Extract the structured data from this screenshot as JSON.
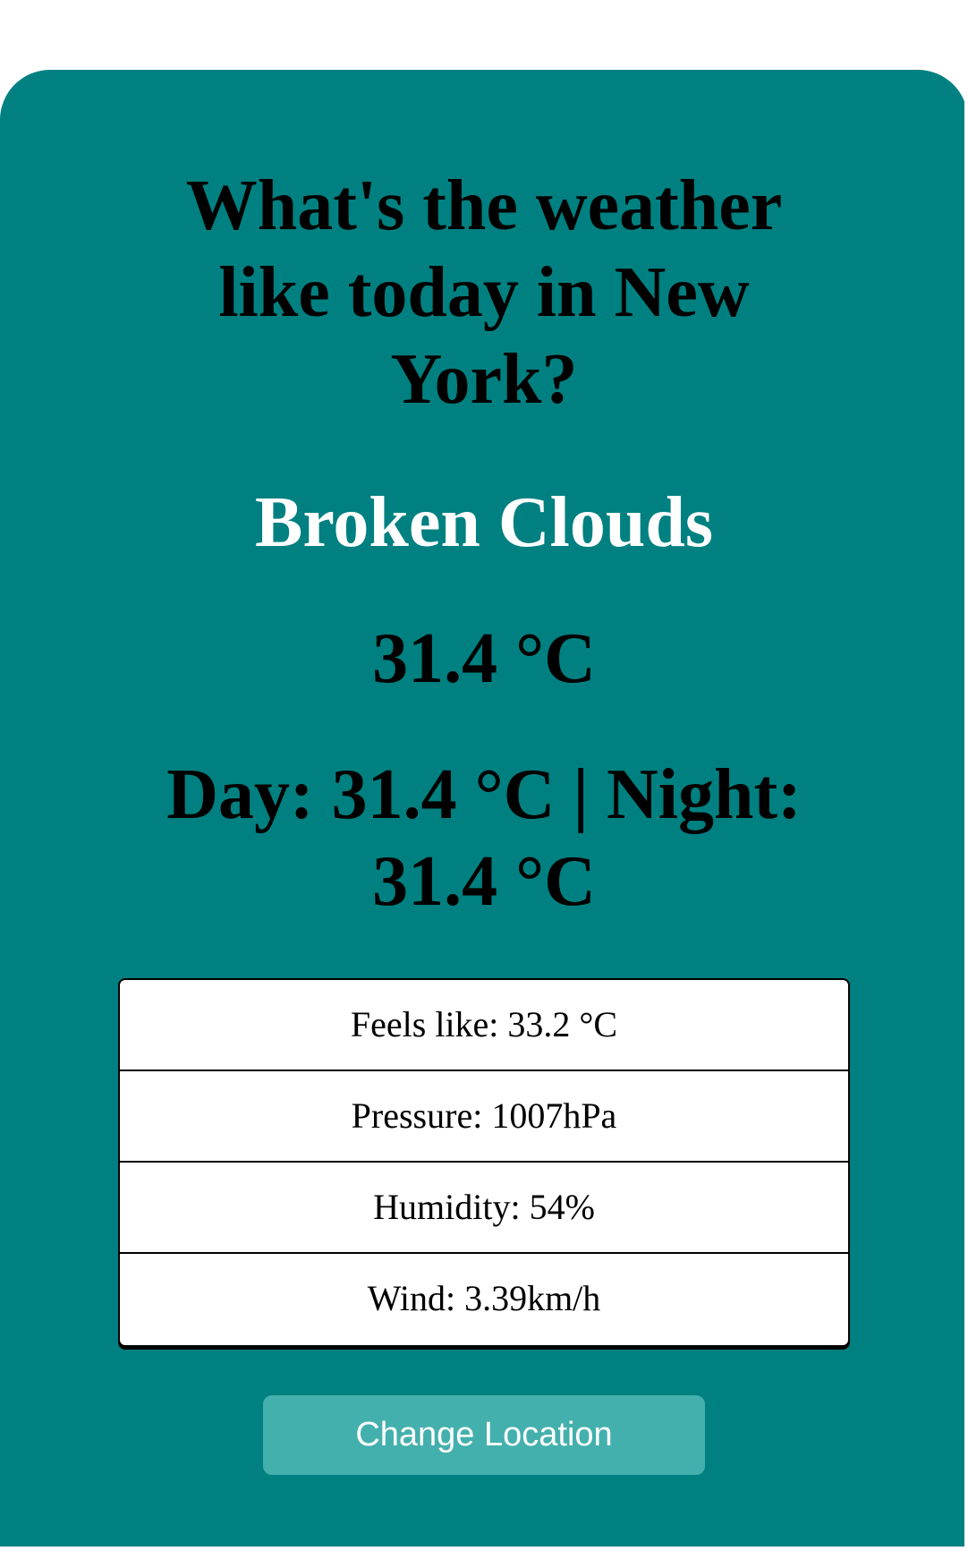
{
  "weather": {
    "question": "What's the weather like today in New York?",
    "description": "Broken Clouds",
    "temperature": "31.4 °C",
    "day_night": "Day: 31.4 °C | Night: 31.4 °C"
  },
  "details": {
    "feels_like": "Feels like: 33.2 °C",
    "pressure": "Pressure: 1007hPa",
    "humidity": "Humidity: 54%",
    "wind": "Wind: 3.39km/h"
  },
  "actions": {
    "change_location_label": "Change Location"
  },
  "colors": {
    "card_background": "#008080",
    "button_background": "#44b0ad",
    "description_text": "#ffffff"
  }
}
